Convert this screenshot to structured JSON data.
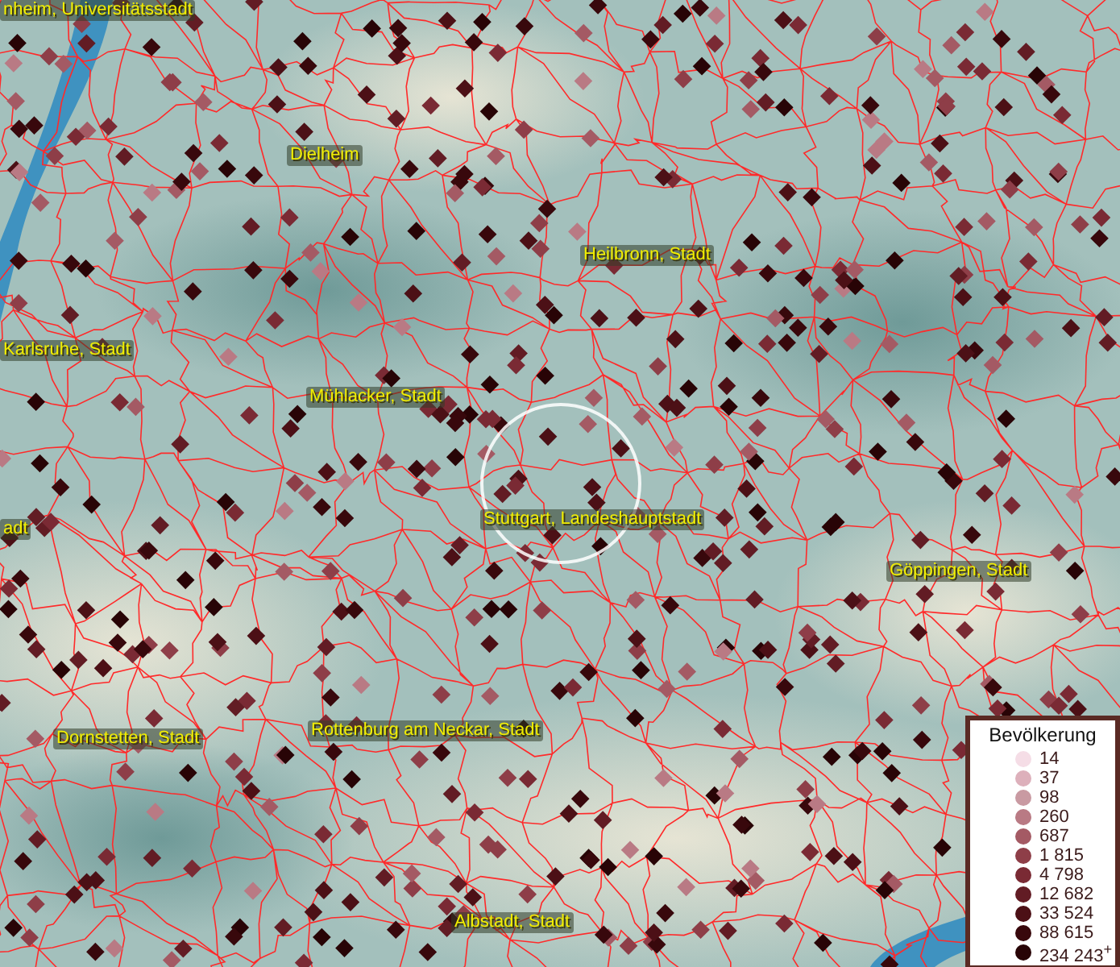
{
  "map": {
    "places": [
      {
        "label": "nheim, Universitätsstadt"
      },
      {
        "label": "Dielheim"
      },
      {
        "label": "Heilbronn, Stadt"
      },
      {
        "label": "Karlsruhe, Stadt"
      },
      {
        "label": "Mühlacker, Stadt"
      },
      {
        "label": "Stuttgart, Landeshauptstadt"
      },
      {
        "label": "adt"
      },
      {
        "label": "Göppingen, Stadt"
      },
      {
        "label": "Dornstetten, Stadt"
      },
      {
        "label": "Rottenburg am Neckar, Stadt"
      },
      {
        "label": "Albstadt, Stadt"
      }
    ]
  },
  "legend": {
    "title": "Bevölkerung",
    "items": [
      {
        "label": "14",
        "color": "#f5dde6"
      },
      {
        "label": "37",
        "color": "#ddb0bb"
      },
      {
        "label": "98",
        "color": "#c99aa2"
      },
      {
        "label": "260",
        "color": "#b97a84"
      },
      {
        "label": "687",
        "color": "#a45a64"
      },
      {
        "label": "1 815",
        "color": "#8e3e48"
      },
      {
        "label": "4 798",
        "color": "#7a2a34"
      },
      {
        "label": "12 682",
        "color": "#621c24"
      },
      {
        "label": "33 524",
        "color": "#4c1016"
      },
      {
        "label": "88 615",
        "color": "#38080c"
      },
      {
        "label": "234 243$^{+}$",
        "color": "#280406"
      }
    ]
  }
}
